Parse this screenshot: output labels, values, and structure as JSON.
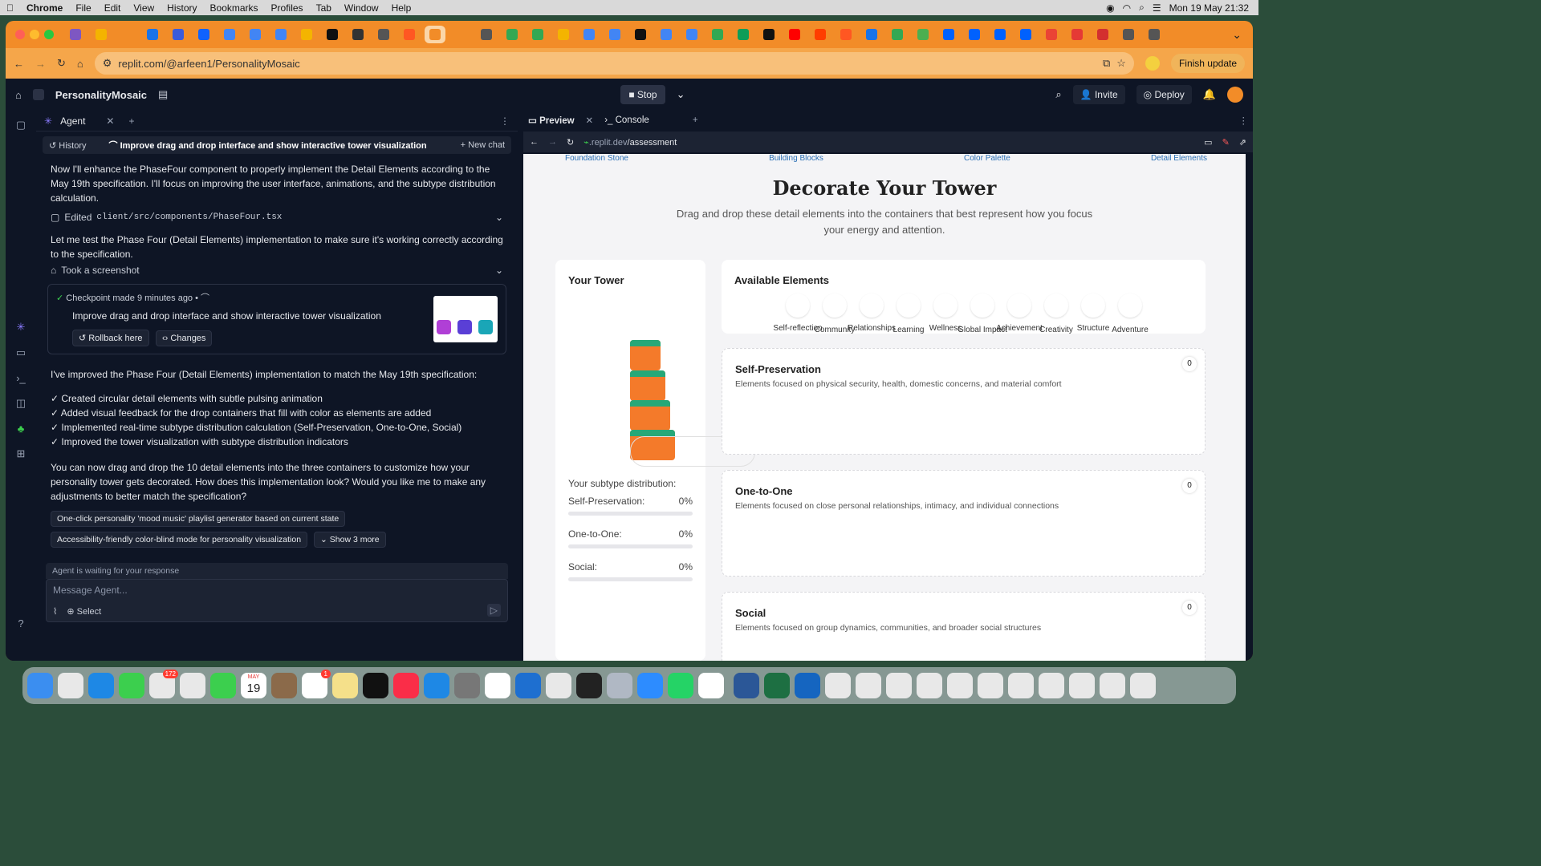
{
  "menubar": {
    "app": "Chrome",
    "items": [
      "File",
      "Edit",
      "View",
      "History",
      "Bookmarks",
      "Profiles",
      "Tab",
      "Window",
      "Help"
    ],
    "clock": "Mon 19 May  21:32"
  },
  "browser": {
    "url": "replit.com/@arfeen1/PersonalityMosaic",
    "finish_update": "Finish update",
    "tab_colors": [
      "#7e57c2",
      "#f4b400",
      "#f28c28",
      "#1a73e8",
      "#3b5bdb",
      "#0f62fe",
      "#4285f4",
      "#4285f4",
      "#4285f4",
      "#f4b400",
      "#111111",
      "#333333",
      "#555555",
      "#ff5722",
      "#f28c28",
      "#f28c28",
      "#555555",
      "#34a853",
      "#34a853",
      "#f4b400",
      "#4285f4",
      "#4285f4",
      "#111111",
      "#4285f4",
      "#4285f4",
      "#34a853",
      "#0f9d58",
      "#111111",
      "#ff0000",
      "#ff3d00",
      "#ff5722",
      "#1a73e8",
      "#34a853",
      "#4caf50",
      "#0061fe",
      "#0061fe",
      "#0061fe",
      "#0061fe",
      "#ea4335",
      "#e53935",
      "#d32f2f",
      "#555555",
      "#555555"
    ]
  },
  "app": {
    "project": "PersonalityMosaic",
    "stop": "Stop",
    "invite": "Invite",
    "deploy": "Deploy"
  },
  "agent": {
    "tab": "Agent",
    "history": "History",
    "chat_title": "Improve drag and drop interface and show interactive tower visualization",
    "new_chat": "New chat",
    "msg1": "Now I'll enhance the PhaseFour component to properly implement the Detail Elements according to the May 19th specification. I'll focus on improving the user interface, animations, and the subtype distribution calculation.",
    "edited_prefix": "Edited",
    "edited_file": "client/src/components/PhaseFour.tsx",
    "msg2": "Let me test the Phase Four (Detail Elements) implementation to make sure it's working correctly according to the specification.",
    "screenshot": "Took a screenshot",
    "checkpoint_label": "Checkpoint made",
    "checkpoint_time": "9 minutes ago",
    "checkpoint_title": "Improve drag and drop interface and show interactive tower visualization",
    "rollback": "Rollback here",
    "changes": "Changes",
    "msg3": "I've improved the Phase Four (Detail Elements) implementation to match the May 19th specification:",
    "bullets": [
      "✓ Created circular detail elements with subtle pulsing animation",
      "✓ Added visual feedback for the drop containers that fill with color as elements are added",
      "✓ Implemented real-time subtype distribution calculation (Self-Preservation, One-to-One, Social)",
      "✓ Improved the tower visualization with subtype distribution indicators"
    ],
    "msg4": "You can now drag and drop the 10 detail elements into the three containers to customize how your personality tower gets decorated. How does this implementation look? Would you like me to make any adjustments to better match the specification?",
    "suggestion1": "One-click personality 'mood music' playlist generator based on current state",
    "suggestion2": "Accessibility-friendly color-blind mode for personality visualization",
    "show_more": "Show 3 more",
    "waiting": "Agent is waiting for your response",
    "input_placeholder": "Message Agent...",
    "select": "Select"
  },
  "preview": {
    "tab_preview": "Preview",
    "tab_console": "Console",
    "url_prefix": ".replit.dev",
    "url_path": "/assessment",
    "steps": [
      "Foundation Stone",
      "Building Blocks",
      "Color Palette",
      "Detail Elements"
    ],
    "title": "Decorate Your Tower",
    "subtitle": "Drag and drop these detail elements into the containers that best represent how you focus your energy and attention.",
    "tower_heading": "Your Tower",
    "available_heading": "Available Elements",
    "elements": [
      "Self-reflection",
      "Community",
      "Relationships",
      "Learning",
      "Wellness",
      "Global Impact",
      "Achievement",
      "Creativity",
      "Structure",
      "Adventure"
    ],
    "distribution_heading": "Your subtype distribution:",
    "distribution": [
      {
        "label": "Self-Preservation:",
        "value": "0%",
        "fraction": 0
      },
      {
        "label": "One-to-One:",
        "value": "0%",
        "fraction": 0
      },
      {
        "label": "Social:",
        "value": "0%",
        "fraction": 0
      }
    ],
    "containers": [
      {
        "title": "Self-Preservation",
        "desc": "Elements focused on physical security, health, domestic concerns, and material comfort",
        "count": "0"
      },
      {
        "title": "One-to-One",
        "desc": "Elements focused on close personal relationships, intimacy, and individual connections",
        "count": "0"
      },
      {
        "title": "Social",
        "desc": "Elements focused on group dynamics, communities, and broader social structures",
        "count": "0"
      }
    ]
  },
  "dock": {
    "calendar_month": "MAY",
    "calendar_day": "19",
    "mail_badge": "172",
    "reminders_badge": "1",
    "icon_colors": [
      "#3b8ef0",
      "#e8e8e8",
      "#1e88e5",
      "#3ccf4e",
      "#e8e8e8",
      "#e8e8e8",
      "#3ccf4e",
      "#ffffff",
      "#8b6a4a",
      "#ffffff",
      "#f5e08a",
      "#111111",
      "#fa2d48",
      "#1e88e5",
      "#777777",
      "#ffffff",
      "#1e6fd0",
      "#e8e8e8",
      "#222222",
      "#b0b8c4",
      "#2d8cff",
      "#25d366",
      "#ffffff",
      "#2b5797",
      "#1d6f42",
      "#1565c0",
      "#e8e8e8",
      "#e8e8e8",
      "#e8e8e8",
      "#e8e8e8",
      "#e8e8e8",
      "#e8e8e8",
      "#e8e8e8",
      "#e8e8e8",
      "#e8e8e8",
      "#e8e8e8",
      "#e8e8e8"
    ]
  }
}
